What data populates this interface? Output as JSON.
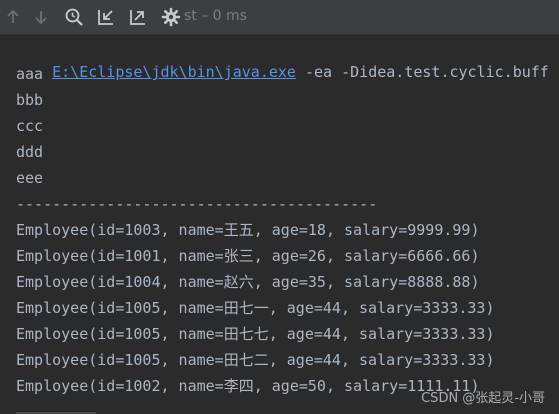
{
  "toolbar": {
    "status_text": "st – 0 ms",
    "icons": [
      "arrow-up-icon",
      "arrow-down-icon",
      "zoom-history-icon",
      "collapse-icon",
      "expand-icon",
      "settings-icon"
    ]
  },
  "console": {
    "command": {
      "path": "E:\\Eclipse\\jdk\\bin\\java.exe",
      "args": " -ea -Didea.test.cyclic.buff"
    },
    "lines": [
      "aaa",
      "bbb",
      "ccc",
      "ddd",
      "eee",
      "----------------------------------------",
      "Employee(id=1003, name=王五, age=18, salary=9999.99)",
      "Employee(id=1001, name=张三, age=26, salary=6666.66)",
      "Employee(id=1004, name=赵六, age=35, salary=8888.88)",
      "Employee(id=1005, name=田七一, age=44, salary=3333.33)",
      "Employee(id=1005, name=田七七, age=44, salary=3333.33)",
      "Employee(id=1005, name=田七二, age=44, salary=3333.33)",
      "Employee(id=1002, name=李四, age=50, salary=1111.11)"
    ]
  },
  "watermark": "CSDN @张起灵-小哥",
  "colors": {
    "background": "#2b2b2b",
    "toolbar": "#3c3f41",
    "text": "#a9b7c6",
    "link": "#5394ec"
  }
}
